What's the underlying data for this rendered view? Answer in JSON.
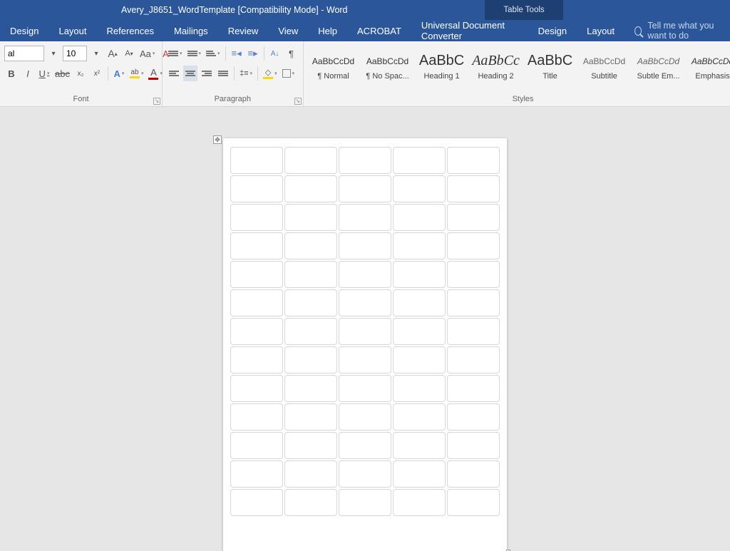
{
  "titlebar": {
    "title": "Avery_J8651_WordTemplate [Compatibility Mode]  -  Word",
    "tabletools": "Table Tools"
  },
  "tabs": {
    "items": [
      "Design",
      "Layout",
      "References",
      "Mailings",
      "Review",
      "View",
      "Help",
      "ACROBAT",
      "Universal Document Converter",
      "Design",
      "Layout"
    ],
    "tellme_placeholder": "Tell me what you want to do"
  },
  "font": {
    "group_label": "Font",
    "name": "al",
    "size": "10",
    "grow": "A",
    "shrink": "A",
    "case": "Aa",
    "clear": "A",
    "bold": "B",
    "italic": "I",
    "underline": "U",
    "strike": "abc",
    "sub": "x₂",
    "sup": "x²",
    "texteffects": "A",
    "highlight": "ab",
    "color": "A"
  },
  "paragraph": {
    "group_label": "Paragraph",
    "bullets": "•",
    "numbers": "1",
    "multilist": "≡",
    "dec_indent": "⇤",
    "inc_indent": "⇥",
    "sort": "A↓",
    "marks": "¶",
    "align_l": "≡",
    "align_c": "≡",
    "align_r": "≡",
    "align_j": "≡",
    "spacing": "↕",
    "shading": "▭",
    "borders": "▦"
  },
  "styles": {
    "group_label": "Styles",
    "items": [
      {
        "preview": "AaBbCcDd",
        "name": "¶ Normal",
        "big": false,
        "serif": false,
        "italic": false,
        "color": "#333"
      },
      {
        "preview": "AaBbCcDd",
        "name": "¶ No Spac...",
        "big": false,
        "serif": false,
        "italic": false,
        "color": "#333"
      },
      {
        "preview": "AaBbC",
        "name": "Heading 1",
        "big": true,
        "serif": false,
        "italic": false,
        "color": "#333"
      },
      {
        "preview": "AaBbCc",
        "name": "Heading 2",
        "big": true,
        "serif": true,
        "italic": true,
        "color": "#333"
      },
      {
        "preview": "AaBbC",
        "name": "Title",
        "big": true,
        "serif": false,
        "italic": false,
        "color": "#333"
      },
      {
        "preview": "AaBbCcDd",
        "name": "Subtitle",
        "big": false,
        "serif": false,
        "italic": false,
        "color": "#666"
      },
      {
        "preview": "AaBbCcDd",
        "name": "Subtle Em...",
        "big": false,
        "serif": false,
        "italic": true,
        "color": "#666"
      },
      {
        "preview": "AaBbCcDd",
        "name": "Emphasis",
        "big": false,
        "serif": false,
        "italic": true,
        "color": "#333"
      }
    ]
  },
  "document": {
    "label_rows": 13,
    "label_cols": 5
  }
}
